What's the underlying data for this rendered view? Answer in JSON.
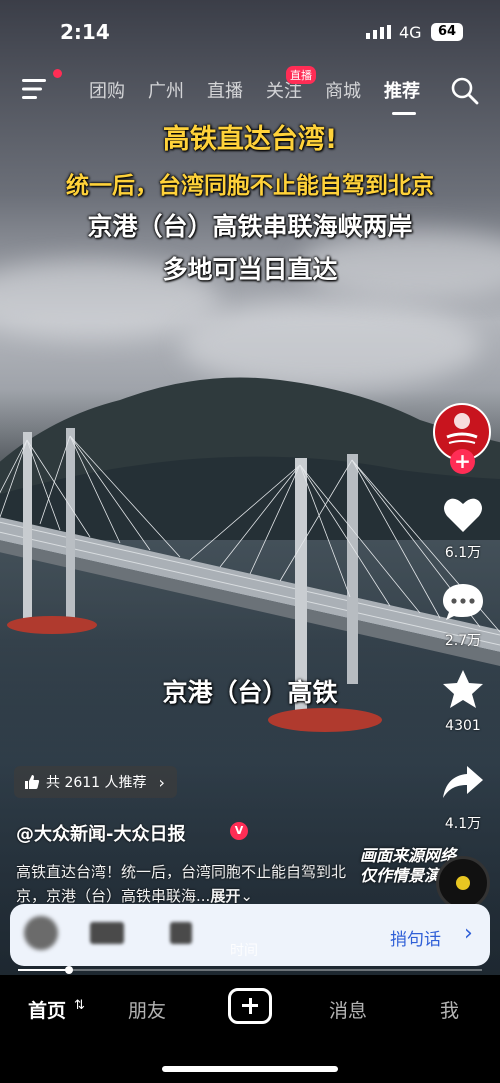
{
  "status_bar": {
    "time": "2:14",
    "network": "4G",
    "battery": "64"
  },
  "top_nav": {
    "tabs": [
      "团购",
      "广州",
      "直播",
      "关注",
      "商城",
      "推荐"
    ],
    "active_tab": "推荐",
    "live_badge": "直播"
  },
  "video": {
    "headline_1": "高铁直达台湾!",
    "headline_2": "统一后，台湾同胞不止能自驾到北京",
    "headline_3": "京港（台）高铁串联海峡两岸",
    "headline_4": "多地可当日直达",
    "caption": "京港（台）高铁",
    "watermark_1": "画面来源网络",
    "watermark_2": "仅作情景演示"
  },
  "right_rail": {
    "likes": "6.1万",
    "comments": "2.7万",
    "favorites": "4301",
    "shares": "4.1万"
  },
  "recommend": {
    "label": "共 2611 人推荐"
  },
  "author": {
    "name": "@大众新闻-大众日报"
  },
  "description": {
    "text": "高铁直达台湾！统一后，台湾同胞不止能自驾到北京，京港（台）高铁串联海...",
    "expand": "展开"
  },
  "search_card": {
    "link": "捎句话"
  },
  "progress": {
    "label": "时间",
    "fraction": 0.11
  },
  "bottom_nav": {
    "tabs": [
      "首页",
      "朋友",
      "消息",
      "我"
    ],
    "active": "首页"
  }
}
